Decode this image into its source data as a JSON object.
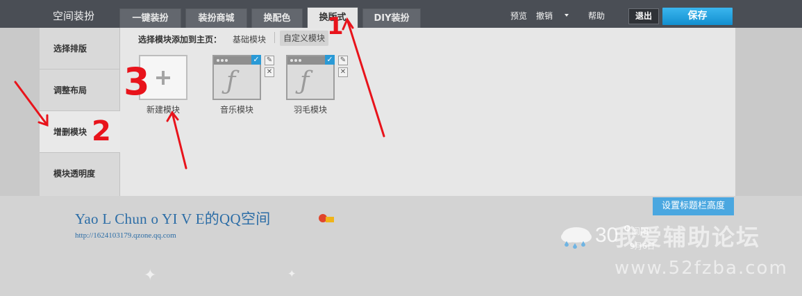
{
  "app": {
    "title": "空间装扮"
  },
  "tabs": [
    {
      "label": "一键装扮"
    },
    {
      "label": "装扮商城"
    },
    {
      "label": "换配色"
    },
    {
      "label": "换版式"
    },
    {
      "label": "DIY装扮"
    }
  ],
  "active_tab": "换版式",
  "toolbar": {
    "preview": "预览",
    "undo": "撤销",
    "help": "帮助",
    "exit": "退出",
    "save": "保存"
  },
  "sidebar": {
    "items": [
      {
        "label": "选择排版"
      },
      {
        "label": "调整布局"
      },
      {
        "label": "增删模块"
      },
      {
        "label": "模块透明度"
      }
    ]
  },
  "panel": {
    "select_label": "选择模块添加到主页：",
    "subtab_basic": "基础模块",
    "subtab_custom": "自定义模块",
    "modules": [
      {
        "label": "新建模块",
        "icon": "plus-icon"
      },
      {
        "label": "音乐模块",
        "icon": "flash-icon"
      },
      {
        "label": "羽毛模块",
        "icon": "flash-icon"
      }
    ]
  },
  "header": {
    "set_height_button": "设置标题栏高度",
    "space_title": "Yao L Chun o YI V E的QQ空间",
    "space_url": "http://1624103179.qzone.qq.com"
  },
  "weather": {
    "temp": "30",
    "city": "阆阳",
    "date": "9月6日"
  },
  "watermark": {
    "line1": "我爱辅助论坛",
    "line2": "www.52fzba.com"
  },
  "annotations": {
    "one": "1",
    "two": "2",
    "three": "3"
  },
  "colors": {
    "accent": "#1a9ae0",
    "topbar": "#4a4e55",
    "annotation": "#e8131b"
  }
}
